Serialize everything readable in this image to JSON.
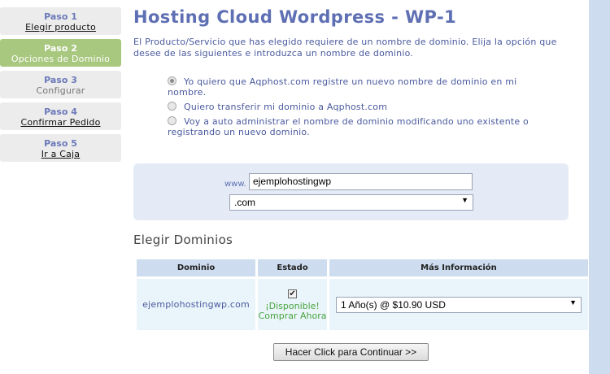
{
  "steps": [
    {
      "num": "Paso 1",
      "label": "Elegir producto"
    },
    {
      "num": "Paso 2",
      "label": "Opciones de Dominio"
    },
    {
      "num": "Paso 3",
      "label": "Configurar"
    },
    {
      "num": "Paso 4",
      "label": "Confirmar Pedido"
    },
    {
      "num": "Paso 5",
      "label": "Ir a Caja"
    }
  ],
  "page": {
    "title": "Hosting Cloud Wordpress - WP-1",
    "intro": "El Producto/Servicio que has elegido requiere de un nombre de dominio. Elija la opción que desee de las siguientes e introduzca un nombre de dominio."
  },
  "options": [
    {
      "label": "Yo quiero que Aqphost.com registre un nuevo nombre de dominio en mi nombre.",
      "checked": true
    },
    {
      "label": "Quiero transferir mi dominio a Aqphost.com",
      "checked": false
    },
    {
      "label": "Voy a auto administrar el nombre de dominio modificando uno existente o registrando un nuevo dominio.",
      "checked": false
    }
  ],
  "domain": {
    "prefix": "www.",
    "value": "ejemplohostingwp",
    "tld": ".com"
  },
  "choose": {
    "title": "Elegir Dominios",
    "headers": {
      "domain": "Dominio",
      "status": "Estado",
      "info": "Más Información"
    },
    "row": {
      "domain": "ejemplohostingwp.com",
      "status": "¡Disponible! Comprar Ahora",
      "period": "1 Año(s) @ $10.90 USD"
    }
  },
  "continue_label": "Hacer Click para Continuar >>",
  "colors": {
    "title": "#5e6fb3",
    "active_step": "#a8c77f",
    "available": "#49a43f",
    "header_bg": "#cddcee"
  }
}
